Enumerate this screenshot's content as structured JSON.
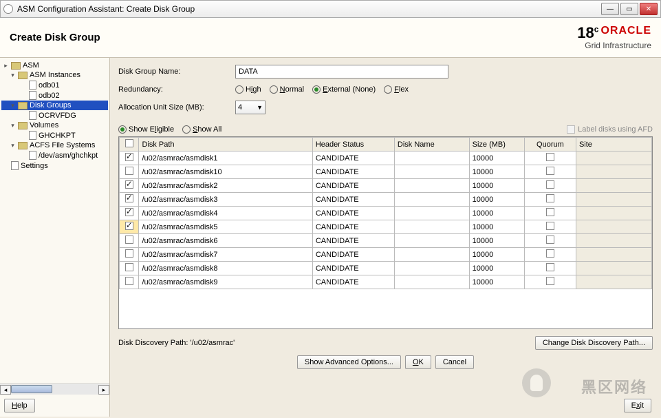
{
  "window": {
    "title": "ASM Configuration Assistant: Create Disk Group"
  },
  "header": {
    "title": "Create Disk Group"
  },
  "brand": {
    "version": "18",
    "super": "c",
    "name": "ORACLE",
    "sub": "Grid Infrastructure"
  },
  "sidebar": {
    "items": [
      {
        "label": "ASM",
        "icon": "folder",
        "indent": 0,
        "toggle": "▸"
      },
      {
        "label": "ASM Instances",
        "icon": "folder",
        "indent": 1,
        "toggle": "▾"
      },
      {
        "label": "odb01",
        "icon": "doc",
        "indent": 2,
        "toggle": ""
      },
      {
        "label": "odb02",
        "icon": "doc",
        "indent": 2,
        "toggle": ""
      },
      {
        "label": "Disk Groups",
        "icon": "folder",
        "indent": 1,
        "toggle": "▾",
        "selected": true
      },
      {
        "label": "OCRVFDG",
        "icon": "doc",
        "indent": 2,
        "toggle": ""
      },
      {
        "label": "Volumes",
        "icon": "folder",
        "indent": 1,
        "toggle": "▾"
      },
      {
        "label": "GHCHKPT",
        "icon": "doc",
        "indent": 2,
        "toggle": ""
      },
      {
        "label": "ACFS File Systems",
        "icon": "folder",
        "indent": 1,
        "toggle": "▾"
      },
      {
        "label": "/dev/asm/ghchkpt",
        "icon": "doc",
        "indent": 2,
        "toggle": ""
      },
      {
        "label": "Settings",
        "icon": "doc",
        "indent": 0,
        "toggle": ""
      }
    ]
  },
  "form": {
    "name_label": "Disk Group Name:",
    "name_value": "DATA",
    "redundancy_label": "Redundancy:",
    "redundancy_opts": [
      "High",
      "Normal",
      "External (None)",
      "Flex"
    ],
    "redundancy_sel": 2,
    "ausize_label": "Allocation Unit Size (MB):",
    "ausize_value": "4",
    "filter_opts": [
      "Show Eligible",
      "Show All"
    ],
    "filter_sel": 0,
    "afd_label": "Label disks using AFD"
  },
  "table": {
    "cols": [
      "",
      "Disk Path",
      "Header Status",
      "Disk Name",
      "Size (MB)",
      "Quorum",
      "Site"
    ],
    "rows": [
      {
        "checked": true,
        "path": "/u02/asmrac/asmdisk1",
        "status": "CANDIDATE",
        "name": "",
        "size": "10000",
        "quorum": false,
        "site": "",
        "hi": false
      },
      {
        "checked": false,
        "path": "/u02/asmrac/asmdisk10",
        "status": "CANDIDATE",
        "name": "",
        "size": "10000",
        "quorum": false,
        "site": "",
        "hi": false
      },
      {
        "checked": true,
        "path": "/u02/asmrac/asmdisk2",
        "status": "CANDIDATE",
        "name": "",
        "size": "10000",
        "quorum": false,
        "site": "",
        "hi": false
      },
      {
        "checked": true,
        "path": "/u02/asmrac/asmdisk3",
        "status": "CANDIDATE",
        "name": "",
        "size": "10000",
        "quorum": false,
        "site": "",
        "hi": false
      },
      {
        "checked": true,
        "path": "/u02/asmrac/asmdisk4",
        "status": "CANDIDATE",
        "name": "",
        "size": "10000",
        "quorum": false,
        "site": "",
        "hi": false
      },
      {
        "checked": true,
        "path": "/u02/asmrac/asmdisk5",
        "status": "CANDIDATE",
        "name": "",
        "size": "10000",
        "quorum": false,
        "site": "",
        "hi": true
      },
      {
        "checked": false,
        "path": "/u02/asmrac/asmdisk6",
        "status": "CANDIDATE",
        "name": "",
        "size": "10000",
        "quorum": false,
        "site": "",
        "hi": false
      },
      {
        "checked": false,
        "path": "/u02/asmrac/asmdisk7",
        "status": "CANDIDATE",
        "name": "",
        "size": "10000",
        "quorum": false,
        "site": "",
        "hi": false
      },
      {
        "checked": false,
        "path": "/u02/asmrac/asmdisk8",
        "status": "CANDIDATE",
        "name": "",
        "size": "10000",
        "quorum": false,
        "site": "",
        "hi": false
      },
      {
        "checked": false,
        "path": "/u02/asmrac/asmdisk9",
        "status": "CANDIDATE",
        "name": "",
        "size": "10000",
        "quorum": false,
        "site": "",
        "hi": false
      }
    ]
  },
  "discovery": {
    "label": "Disk Discovery Path: '/u02/asmrac'",
    "button": "Change Disk Discovery Path..."
  },
  "buttons": {
    "adv": "Show Advanced Options...",
    "ok": "OK",
    "cancel": "Cancel",
    "help": "Help",
    "exit": "Exit"
  },
  "watermark": "黑区网络"
}
